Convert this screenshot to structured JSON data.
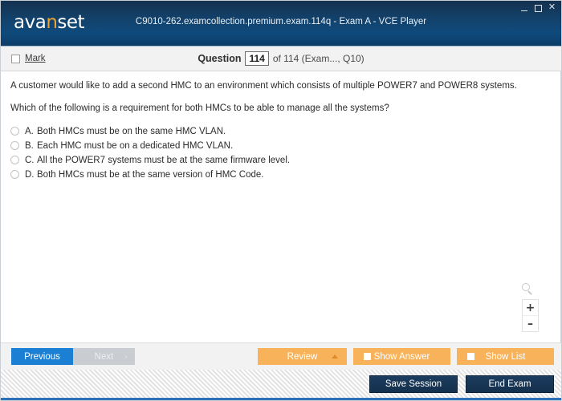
{
  "window": {
    "logo_text_part1": "ava",
    "logo_text_highlight": "n",
    "logo_text_part2": "set",
    "title": "C9010-262.examcollection.premium.exam.114q - Exam A - VCE Player",
    "controls": {
      "minimize": "minimize-icon",
      "maximize": "maximize-icon",
      "close": "✕"
    }
  },
  "question_bar": {
    "mark_label": "Mark",
    "question_label": "Question",
    "question_number": "114",
    "question_suffix": "of 114 (Exam..., Q10)"
  },
  "question": {
    "stem_line1": "A customer would like to add a second HMC to an environment which consists of multiple POWER7 and POWER8 systems.",
    "stem_line2": "Which of the following is a requirement for both HMCs to be able to manage all the systems?",
    "options": [
      {
        "letter": "A.",
        "text": "Both HMCs must be on the same HMC VLAN."
      },
      {
        "letter": "B.",
        "text": "Each HMC must be on a dedicated HMC VLAN."
      },
      {
        "letter": "C.",
        "text": "All the POWER7 systems must be at the same firmware level."
      },
      {
        "letter": "D.",
        "text": "Both HMCs must be at the same version of HMC Code."
      }
    ]
  },
  "zoom_controls": {
    "magnifier": "magnifier-icon",
    "zoom_in": "+",
    "zoom_out": "–"
  },
  "action_bar": {
    "previous_label": "Previous",
    "next_label": "Next",
    "next_chevron": "›",
    "review_label": "Review",
    "show_answer_label": "Show Answer",
    "show_list_label": "Show List"
  },
  "status_bar": {
    "save_session_label": "Save Session",
    "end_exam_label": "End Exam"
  },
  "colors": {
    "header_blue": "#0f4a7c",
    "accent_orange": "#f7b25a",
    "logo_orange": "#f0a22e",
    "primary_blue": "#1b7fd4",
    "dark_button": "#14304d",
    "bottom_rule": "#2d72b8"
  }
}
